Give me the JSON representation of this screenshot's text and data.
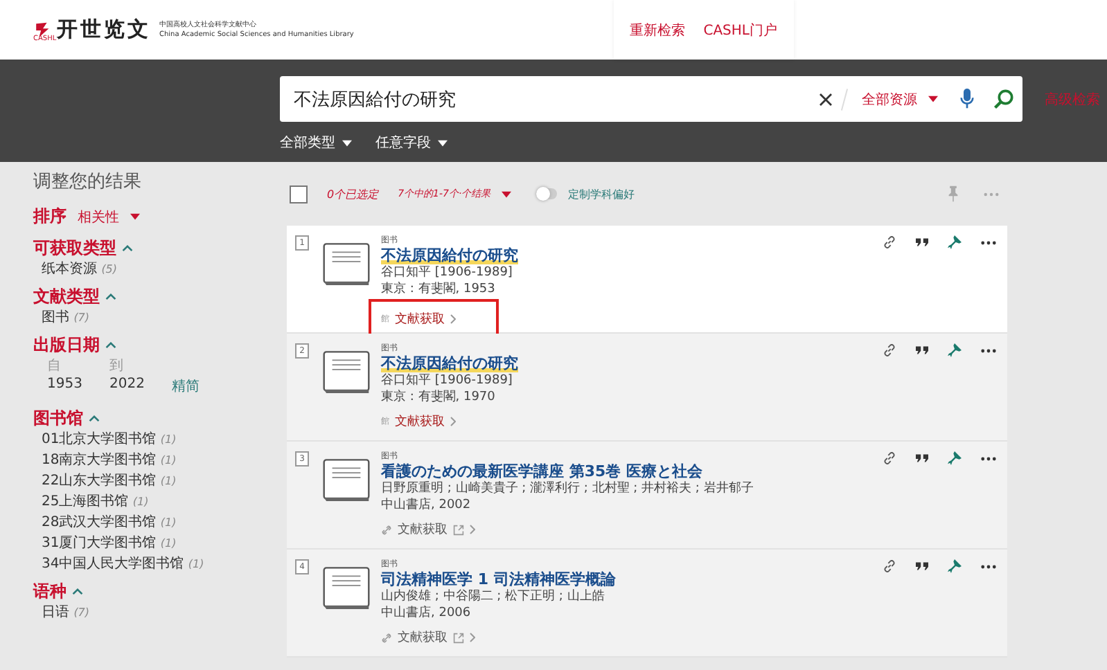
{
  "header": {
    "logo_text": "开世览文",
    "logo_mark_text": "CASHL",
    "logo_subtitle_cn": "中国高校人文社会科学文献中心",
    "logo_subtitle_en": "China Academic Social Sciences and Humanities Library",
    "links": [
      "重新检索",
      "CASHL门户"
    ]
  },
  "search": {
    "value": "不法原因給付の研究",
    "scope": "全部资源",
    "advanced": "高级检索",
    "filters": [
      "全部类型",
      "任意字段"
    ]
  },
  "sidebar": {
    "title": "调整您的结果",
    "sort_label": "排序",
    "sort_value": "相关性",
    "facets": [
      {
        "title": "可获取类型",
        "items": [
          {
            "label": "纸本资源",
            "count": "(5)"
          }
        ]
      },
      {
        "title": "文献类型",
        "items": [
          {
            "label": "图书",
            "count": "(7)"
          }
        ]
      },
      {
        "title": "出版日期",
        "kind": "range",
        "from_label": "自",
        "to_label": "到",
        "from": "1953",
        "to": "2022",
        "action": "精简"
      },
      {
        "title": "图书馆",
        "items": [
          {
            "label": "01北京大学图书馆",
            "count": "(1)"
          },
          {
            "label": "18南京大学图书馆",
            "count": "(1)"
          },
          {
            "label": "22山东大学图书馆",
            "count": "(1)"
          },
          {
            "label": "25上海图书馆",
            "count": "(1)"
          },
          {
            "label": "28武汉大学图书馆",
            "count": "(1)"
          },
          {
            "label": "31厦门大学图书馆",
            "count": "(1)"
          },
          {
            "label": "34中国人民大学图书馆",
            "count": "(1)"
          }
        ]
      },
      {
        "title": "语种",
        "items": [
          {
            "label": "日语",
            "count": "(7)"
          }
        ]
      }
    ]
  },
  "toolbar": {
    "select_all_checked": false,
    "selected_count": "0个已选定",
    "range": "7个中的1-7个·个结果",
    "toggle_label": "定制学科偏好",
    "toggle_on": false
  },
  "results": [
    {
      "number": "1",
      "type": "图书",
      "title": "不法原因給付の研究",
      "highlight": true,
      "lines": [
        "谷口知平 [1906-1989]",
        "東京 : 有斐閣, 1953"
      ],
      "kind": "physical",
      "access_icon_text": "館",
      "access": "文献获取",
      "selected": true,
      "boxed": true
    },
    {
      "number": "2",
      "type": "图书",
      "title": "不法原因給付の研究",
      "highlight": true,
      "lines": [
        "谷口知平 [1906-1989]",
        "東京 : 有斐閣, 1970"
      ],
      "kind": "physical",
      "access_icon_text": "館",
      "access": "文献获取",
      "selected": false,
      "boxed": false
    },
    {
      "number": "3",
      "type": "图书",
      "title": "看護のための最新医学講座 第35巻 医療と社会",
      "highlight": false,
      "lines": [
        "日野原重明 ; 山崎美貴子 ; 瀧澤利行 ; 北村聖 ; 井村裕夫 ; 岩井郁子",
        "中山書店, 2002"
      ],
      "kind": "online",
      "access": "文献获取",
      "selected": false,
      "boxed": false
    },
    {
      "number": "4",
      "type": "图书",
      "title": "司法精神医学 1 司法精神医学概論",
      "highlight": false,
      "lines": [
        "山内俊雄 ; 中谷陽二 ; 松下正明 ; 山上皓",
        "中山書店, 2006"
      ],
      "kind": "online",
      "access": "文献获取",
      "selected": false,
      "boxed": false
    }
  ]
}
